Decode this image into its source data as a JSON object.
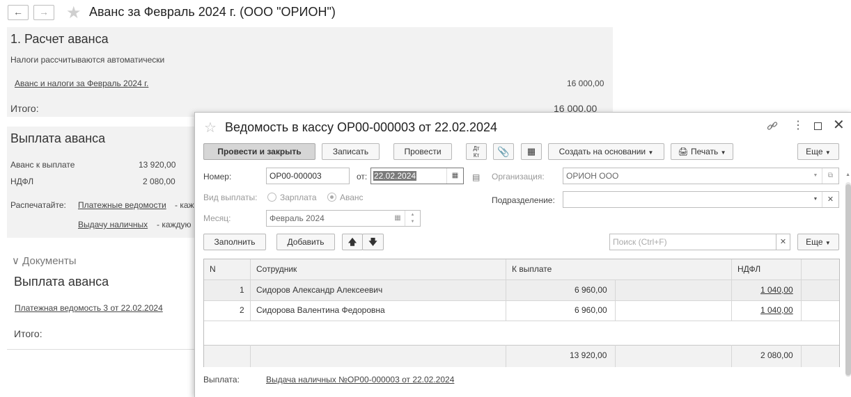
{
  "main": {
    "title": "Аванс за Февраль 2024 г. (ООО \"ОРИОН\")",
    "section1_title": "1. Расчет аванса",
    "taxes_auto": "Налоги рассчитываются автоматически",
    "advance_link": "Аванс и налоги за Февраль 2024 г.",
    "advance_amount": "16 000,00",
    "total_label": "Итого:",
    "total_value": "16 000,00",
    "payout_title": "Выплата аванса",
    "advance_to_pay_label": "Аванс к выплате",
    "advance_to_pay_value": "13 920,00",
    "ndfl_label": "НДФЛ",
    "ndfl_value": "2 080,00",
    "print_label": "Распечатайте:",
    "print_link1": "Платежные ведомости",
    "print_text1": "- каж",
    "print_link2": "Выдачу наличных",
    "print_text2": "- каждую",
    "documents_label": "Документы",
    "docs_title": "Выплата аванса",
    "docs_link": "Платежная ведомость 3 от 22.02.2024",
    "docs_total": "Итого:"
  },
  "dialog": {
    "title": "Ведомость в кассу ОР00-000003 от 22.02.2024",
    "toolbar": {
      "post_close": "Провести и закрыть",
      "save": "Записать",
      "post": "Провести",
      "dt_kt": "Дт Кт",
      "create_based": "Создать на основании",
      "print": "Печать",
      "more": "Еще"
    },
    "number_label": "Номер:",
    "number_value": "ОР00-000003",
    "date_label": "от:",
    "date_value": "22.02.2024",
    "org_label": "Организация:",
    "org_value": "ОРИОН ООО",
    "paytype_label": "Вид выплаты:",
    "paytype_salary": "Зарплата",
    "paytype_advance": "Аванс",
    "division_label": "Подразделение:",
    "division_value": "",
    "month_label": "Месяц:",
    "month_value": "Февраль 2024",
    "fill_button": "Заполнить",
    "add_button": "Добавить",
    "search_placeholder": "Поиск (Ctrl+F)",
    "more2": "Еще",
    "table": {
      "headers": {
        "n": "N",
        "employee": "Сотрудник",
        "to_pay": "К выплате",
        "ndfl": "НДФЛ"
      },
      "rows": [
        {
          "n": "1",
          "employee": "Сидоров Александр Алексеевич",
          "to_pay": "6 960,00",
          "ndfl": "1 040,00"
        },
        {
          "n": "2",
          "employee": "Сидорова Валентина Федоровна",
          "to_pay": "6 960,00",
          "ndfl": "1 040,00"
        }
      ],
      "totals": {
        "to_pay": "13 920,00",
        "ndfl": "2 080,00"
      }
    },
    "payment_label": "Выплата:",
    "payment_link": "Выдача наличных №ОР00-000003 от 22.02.2024"
  }
}
